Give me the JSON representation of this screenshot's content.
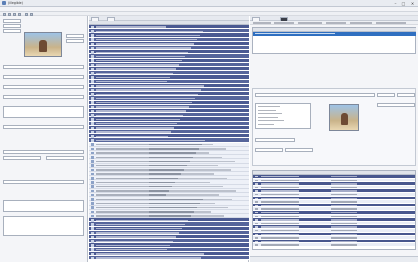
{
  "window": {
    "title": "(illegible)",
    "minimize_glyph": "–",
    "maximize_glyph": "□",
    "close_glyph": "✕"
  },
  "menubar": {
    "items": [
      "",
      "",
      "",
      "",
      "",
      ""
    ]
  },
  "left_panel": {
    "fields": [
      {
        "label": "",
        "value": ""
      },
      {
        "label": "",
        "value": ""
      },
      {
        "label": "",
        "value": ""
      },
      {
        "label": "",
        "value": ""
      },
      {
        "label": "",
        "value": ""
      },
      {
        "label": "",
        "value": ""
      },
      {
        "label": "",
        "value": ""
      },
      {
        "label": "",
        "value": ""
      }
    ]
  },
  "center_panel": {
    "tabs": [
      "",
      ""
    ],
    "columns": [
      "",
      "",
      ""
    ],
    "row_count_note": ""
  },
  "right_panel": {
    "tabs": [
      "",
      ""
    ],
    "detail_labels": [
      "",
      "",
      "",
      ""
    ],
    "track_columns": [
      "",
      "",
      ""
    ]
  },
  "colors": {
    "accent_dark_row": "#4b5a92",
    "selected_row": "#2f6fc0",
    "titlebar": "#e9ecf1"
  },
  "icons": [
    "app-icon",
    "cover-art-image",
    "folder-icon",
    "toolbar-button-icon"
  ]
}
